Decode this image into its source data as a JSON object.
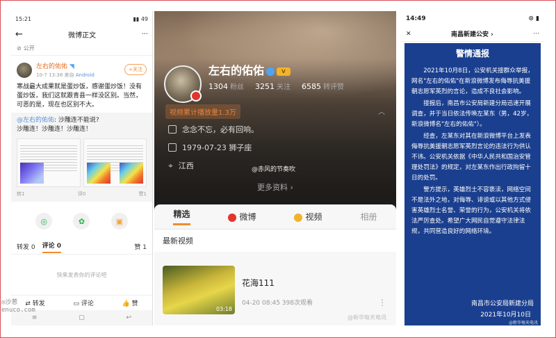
{
  "panel1": {
    "status_time": "15:21",
    "status_right": "▮▮ 49",
    "nav_title": "微博正文",
    "more": "···",
    "visibility": "公开",
    "username": "左右的佑佑",
    "post_time": "10-7 13:38",
    "source_label": "来自",
    "source": "Android",
    "follow_label": "+关注",
    "text": "寒战最大成果就是蛋炒饭，感谢蛋炒饭！没有蛋炒饭，我们这就跟青县一样没区别。当然，可恶的是，现在也区别不大。",
    "repost_user": "@左右的佑佑",
    "repost_text": ": 沙雕连不能说?",
    "repost_line2": "沙雕连！沙雕连！沙雕连！",
    "small_left": "转1",
    "small_mid": "评0",
    "small_right": "赞1",
    "tabs": {
      "repost": "转发 0",
      "comment": "评论 0",
      "like": "赞 1"
    },
    "comment_placeholder": "快来发表你的评论吧",
    "bottom": {
      "repost": "转发",
      "comment": "评论",
      "like": "赞"
    },
    "sys_nav": [
      "≡",
      "▢",
      "↩"
    ],
    "watermark": "◎沙葱\nenuco.com"
  },
  "panel2": {
    "name": "左右的佑佑",
    "badge_level": "V",
    "stats": [
      {
        "value": "1304",
        "label": "粉丝"
      },
      {
        "value": "3251",
        "label": "关注"
      },
      {
        "value": "6585",
        "label": "转评赞"
      }
    ],
    "views": "视频累计播放量1.3万",
    "collapse": "︿",
    "bio": "念念不忘，必有回响。",
    "birthday": "1979-07-23 狮子座",
    "location": "江西",
    "watermark_top": "@赤风的节奏吹",
    "more_info": "更多资料 ›",
    "tabs": [
      "精选",
      "微博",
      "视频",
      "相册"
    ],
    "latest": "最新视频",
    "video_title": "花海111",
    "video_duration": "03:18",
    "video_meta": "04-20 08:45  398次观看",
    "video_more": "⋮",
    "watermark_bottom": "@新华每天电讯"
  },
  "panel3": {
    "status_time": "14:49",
    "status_right": "⊙ ▮",
    "close": "✕",
    "nav_title": "南昌新建公安 ›",
    "more": "···",
    "notice_title": "警情通报",
    "paragraphs": [
      "2021年10月8日，公安机关接群众举报，网名\"左右的佑佑\"在新浪微博发布侮辱抗美援朝志愿军英烈的言论，造成不良社会影响。",
      "接报后，南昌市公安局新建分局迅速开展调查，并于当日依法传唤左某东（男，42岁，新浪微博名\"左右的佑佑\"）。",
      "经查，左某东对其在新浪微博平台上发表侮辱抗美援朝志愿军英烈言论的违法行为供认不讳。公安机关依据《中华人民共和国治安管理处罚法》的规定，对左某东作出行政拘留十日的处罚。",
      "警方提示，英雄烈士不容亵渎，网络空间不是法外之地，对侮辱、诽谤或以其他方式侵害英雄烈士名誉、荣誉的行为，公安机关将依法严厉查处。希望广大网民自觉遵守法律法规，共同营造良好的网络环境。"
    ],
    "signature": "南昌市公安局新建分局",
    "date": "2021年10月10日",
    "watermark": "@新华每天电讯"
  }
}
